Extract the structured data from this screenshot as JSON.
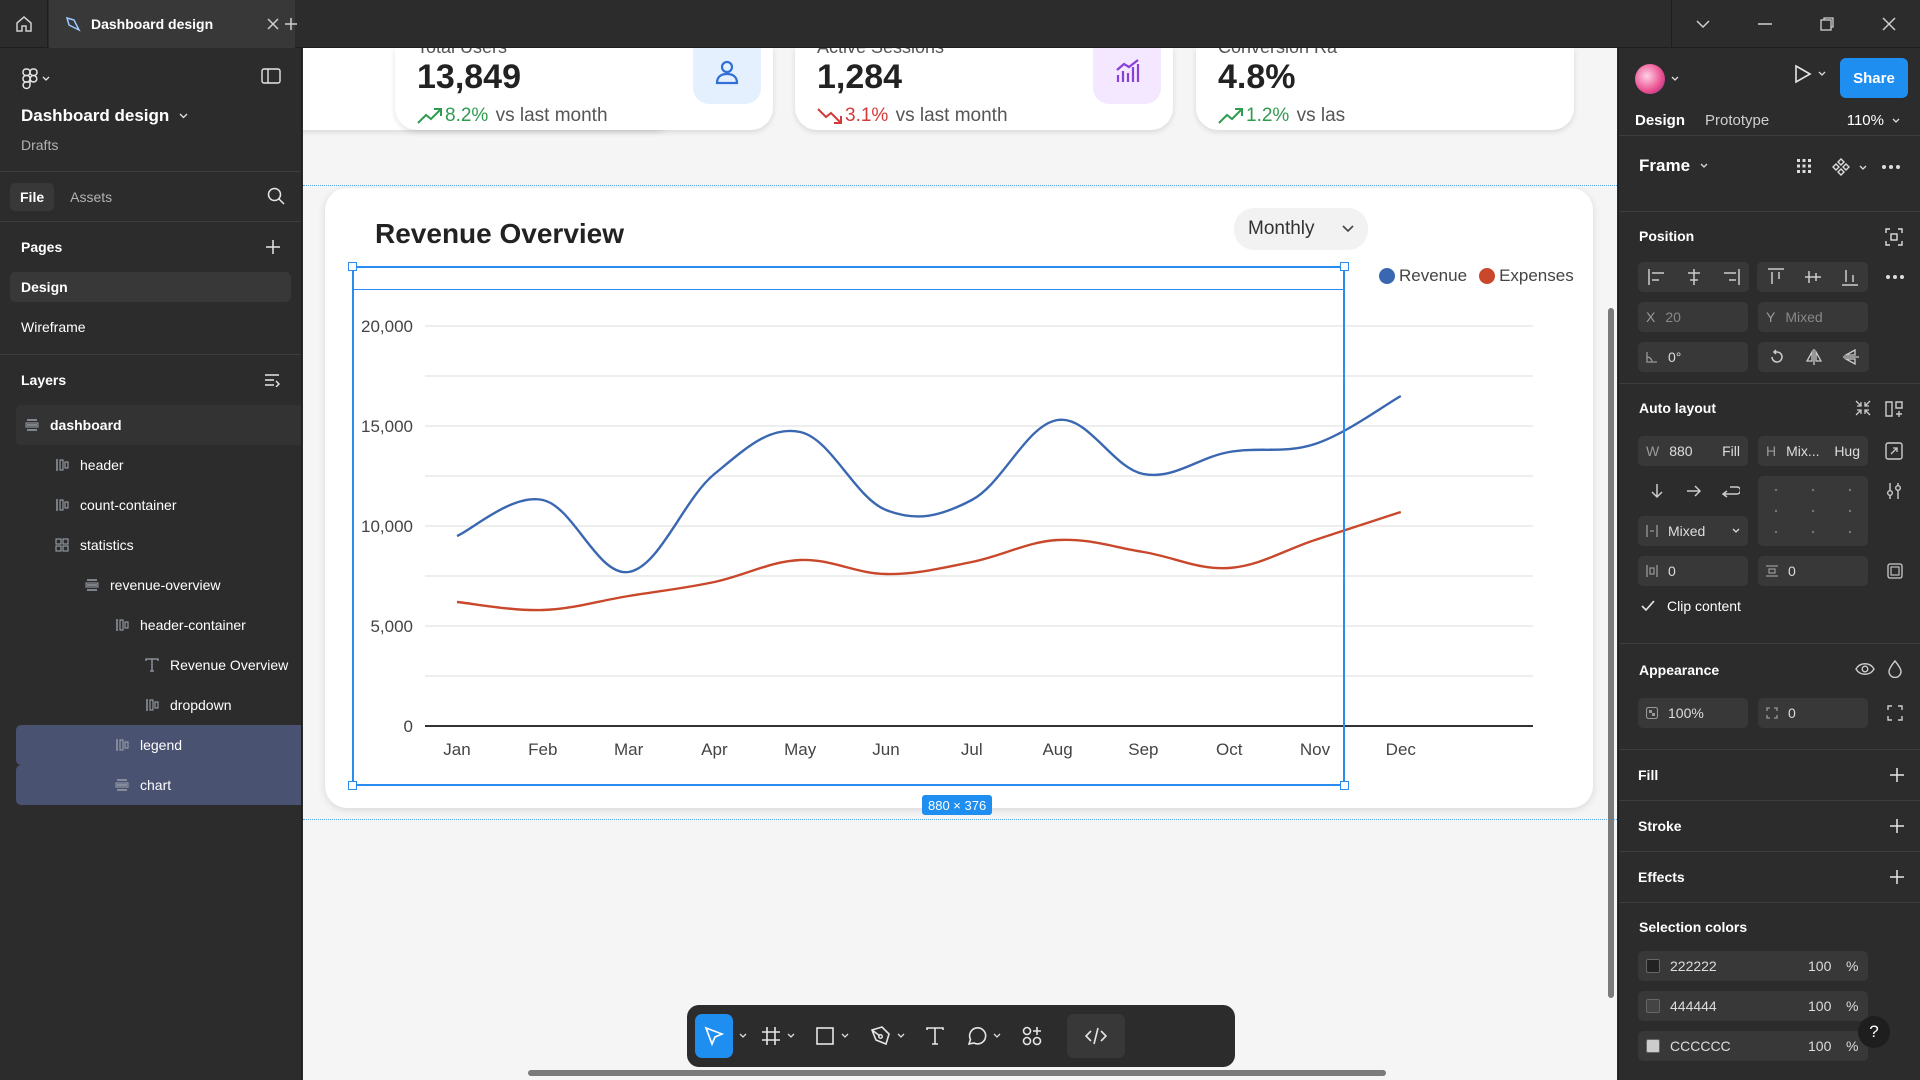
{
  "titlebar": {
    "tab_title": "Dashboard design"
  },
  "left_panel": {
    "file_title": "Dashboard design",
    "file_location": "Drafts",
    "tabs": [
      "File",
      "Assets"
    ],
    "pages_label": "Pages",
    "pages": [
      "Design",
      "Wireframe"
    ],
    "layers_label": "Layers",
    "layers": [
      {
        "name": "dashboard",
        "indent": 0,
        "icon": "autolayout-vertical-icon"
      },
      {
        "name": "header",
        "indent": 1,
        "icon": "autolayout-horizontal-icon"
      },
      {
        "name": "count-container",
        "indent": 1,
        "icon": "autolayout-horizontal-icon"
      },
      {
        "name": "statistics",
        "indent": 1,
        "icon": "grid-layout-icon"
      },
      {
        "name": "revenue-overview",
        "indent": 2,
        "icon": "autolayout-vertical-icon"
      },
      {
        "name": "header-container",
        "indent": 3,
        "icon": "autolayout-horizontal-icon"
      },
      {
        "name": "Revenue Overview",
        "indent": 4,
        "icon": "text-icon"
      },
      {
        "name": "dropdown",
        "indent": 4,
        "icon": "autolayout-horizontal-icon"
      },
      {
        "name": "legend",
        "indent": 3,
        "icon": "autolayout-horizontal-icon"
      },
      {
        "name": "chart",
        "indent": 3,
        "icon": "autolayout-vertical-icon"
      }
    ]
  },
  "canvas": {
    "stat_cards": [
      {
        "label": "",
        "value": "",
        "change_pct": "",
        "change_text": ""
      },
      {
        "label": "Total Users",
        "value": "13,849",
        "change_pct": "8.2%",
        "change_text": " vs last month",
        "trend": "up"
      },
      {
        "label": "Active Sessions",
        "value": "1,284",
        "change_pct": "3.1%",
        "change_text": " vs last month",
        "trend": "down"
      },
      {
        "label": "Conversion Ra",
        "value": "4.8%",
        "change_pct": "1.2%",
        "change_text": " vs las",
        "trend": "up"
      }
    ],
    "revenue_title": "Revenue Overview",
    "dropdown_value": "Monthly",
    "size_badge": "880 × 376",
    "legend": [
      "Revenue",
      "Expenses"
    ]
  },
  "chart_data": {
    "type": "line",
    "title": "Revenue Overview",
    "categories": [
      "Jan",
      "Feb",
      "Mar",
      "Apr",
      "May",
      "Jun",
      "Jul",
      "Aug",
      "Sep",
      "Oct",
      "Nov",
      "Dec"
    ],
    "series": [
      {
        "name": "Revenue",
        "color": "#3a67b1",
        "values": [
          9500,
          11300,
          7700,
          12600,
          14700,
          10800,
          11300,
          15300,
          12600,
          13700,
          14100,
          16500
        ]
      },
      {
        "name": "Expenses",
        "color": "#c9472a",
        "values": [
          6200,
          5800,
          6500,
          7200,
          8300,
          7600,
          8200,
          9300,
          8700,
          7900,
          9300,
          10700
        ]
      }
    ],
    "y_ticks": [
      "0",
      "5,000",
      "10,000",
      "15,000",
      "20,000"
    ],
    "ylim": [
      0,
      20000
    ],
    "grid": true,
    "legend_position": "top-right"
  },
  "toolbar": {
    "tools": [
      "move-tool",
      "frame-tool",
      "shape-tool",
      "pen-tool",
      "text-tool",
      "comment-tool",
      "actions-tool",
      "dev-mode-toggle"
    ]
  },
  "right_panel": {
    "share_label": "Share",
    "tabs": [
      "Design",
      "Prototype"
    ],
    "zoom": "110%",
    "frame_label": "Frame",
    "position_label": "Position",
    "x_label": "X",
    "x_value": "20",
    "y_label": "Y",
    "y_value": "Mixed",
    "rotation_value": "0°",
    "auto_layout_label": "Auto layout",
    "w_label": "W",
    "w_value": "880",
    "w_mode": "Fill",
    "h_label": "H",
    "h_value": "Mix...",
    "h_mode": "Hug",
    "gap_mode": "Mixed",
    "padding_h": "0",
    "padding_v": "0",
    "clip_content": "Clip content",
    "appearance_label": "Appearance",
    "opacity": "100%",
    "radius": "0",
    "fill_label": "Fill",
    "stroke_label": "Stroke",
    "effects_label": "Effects",
    "selection_colors_label": "Selection colors",
    "selection_colors": [
      {
        "hex": "222222",
        "opacity": "100",
        "unit": "%",
        "swatch": "#222222"
      },
      {
        "hex": "444444",
        "opacity": "100",
        "unit": "%",
        "swatch": "#444444"
      },
      {
        "hex": "CCCCCC",
        "opacity": "100",
        "unit": "%",
        "swatch": "#cccccc"
      }
    ],
    "help": "?"
  }
}
